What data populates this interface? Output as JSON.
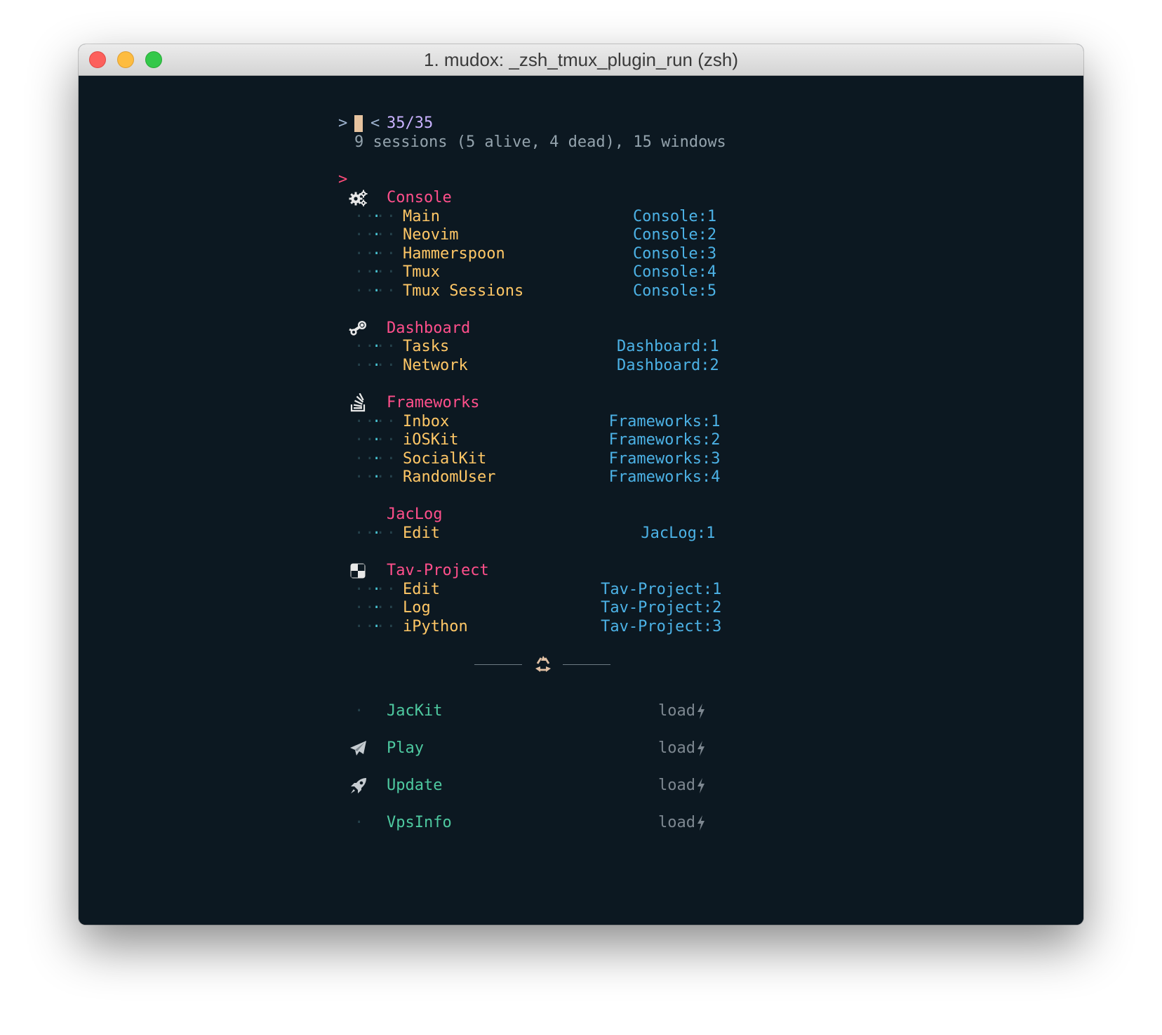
{
  "window": {
    "title": "1. mudox: _zsh_tmux_plugin_run (zsh)"
  },
  "colors": {
    "background": "#0c1821",
    "session": "#ff4f8b",
    "window_name": "#ffc766",
    "target": "#4cb2e6",
    "dead_session": "#4ec9a0",
    "load": "#7d8790",
    "cursor": "#e6c39f",
    "count": "#c9b2ff"
  },
  "prompt": {
    "symbol": ">",
    "count_prefix": "<",
    "count": "35/35",
    "summary": "9 sessions (5 alive, 4 dead), 15 windows",
    "pointer": ">"
  },
  "sessions": [
    {
      "name": "Console",
      "icon": "gears-icon",
      "windows": [
        {
          "name": "Main",
          "target": "Console:1"
        },
        {
          "name": "Neovim",
          "target": "Console:2"
        },
        {
          "name": "Hammerspoon",
          "target": "Console:3"
        },
        {
          "name": "Tmux",
          "target": "Console:4"
        },
        {
          "name": "Tmux Sessions",
          "target": "Console:5"
        }
      ]
    },
    {
      "name": "Dashboard",
      "icon": "steam-icon",
      "windows": [
        {
          "name": "Tasks",
          "target": "Dashboard:1"
        },
        {
          "name": "Network",
          "target": "Dashboard:2"
        }
      ]
    },
    {
      "name": "Frameworks",
      "icon": "stack-overflow-icon",
      "windows": [
        {
          "name": "Inbox",
          "target": "Frameworks:1"
        },
        {
          "name": "iOSKit",
          "target": "Frameworks:2"
        },
        {
          "name": "SocialKit",
          "target": "Frameworks:3"
        },
        {
          "name": "RandomUser",
          "target": "Frameworks:4"
        }
      ]
    },
    {
      "name": "JacLog",
      "icon": "",
      "windows": [
        {
          "name": "Edit",
          "target": "JacLog:1"
        }
      ]
    },
    {
      "name": "Tav-Project",
      "icon": "checker-icon",
      "windows": [
        {
          "name": "Edit",
          "target": "Tav-Project:1"
        },
        {
          "name": "Log",
          "target": "Tav-Project:2"
        },
        {
          "name": "iPython",
          "target": "Tav-Project:3"
        }
      ]
    }
  ],
  "separator": {
    "icon": "recycle-icon",
    "glyph": "♻"
  },
  "dead_sessions": [
    {
      "name": "JacKit",
      "icon": "",
      "action": "load",
      "action_icon": "bolt-icon"
    },
    {
      "name": "Play",
      "icon": "paper-plane-icon",
      "action": "load",
      "action_icon": "bolt-icon"
    },
    {
      "name": "Update",
      "icon": "rocket-icon",
      "action": "load",
      "action_icon": "bolt-icon"
    },
    {
      "name": "VpsInfo",
      "icon": "",
      "action": "load",
      "action_icon": "bolt-icon"
    }
  ]
}
